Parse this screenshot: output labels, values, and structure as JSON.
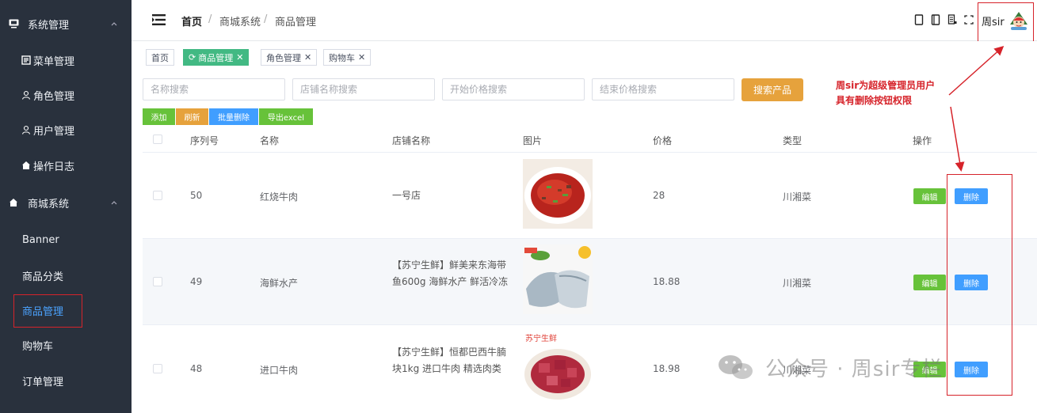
{
  "sidebar": {
    "group1": "系统管理",
    "items1": [
      "菜单管理",
      "角色管理",
      "用户管理",
      "操作日志"
    ],
    "group2": "商城系统",
    "items2": [
      "Banner",
      "商品分类",
      "商品管理",
      "购物车",
      "订单管理"
    ]
  },
  "header": {
    "breadcrumb": [
      "首页",
      "商城系统",
      "商品管理"
    ],
    "username": "周sir"
  },
  "tags": [
    "首页",
    "商品管理",
    "角色管理",
    "购物车"
  ],
  "search": {
    "name_placeholder": "名称搜索",
    "shop_placeholder": "店铺名称搜索",
    "min_price_placeholder": "开始价格搜索",
    "max_price_placeholder": "结束价格搜索",
    "button": "搜索产品"
  },
  "actions": {
    "add": "添加",
    "refresh": "刷新",
    "batch_delete": "批量删除",
    "export": "导出excel"
  },
  "table": {
    "columns": [
      "序列号",
      "名称",
      "店铺名称",
      "图片",
      "价格",
      "类型",
      "操作"
    ],
    "rows": [
      {
        "id": "50",
        "name": "红烧牛肉",
        "shop": "一号店",
        "price": "28",
        "type": "川湘菜"
      },
      {
        "id": "49",
        "name": "海鲜水产",
        "shop": "【苏宁生鲜】鲜美来东海带鱼600g 海鲜水产 鲜活冷冻",
        "price": "18.88",
        "type": "川湘菜"
      },
      {
        "id": "48",
        "name": "进口牛肉",
        "shop": "【苏宁生鲜】恒都巴西牛腩块1kg 进口牛肉 精选肉类",
        "price": "18.98",
        "type": "川湘菜"
      }
    ],
    "edit_label": "编辑",
    "delete_label": "删除",
    "image_badge": "苏宁生鲜"
  },
  "annotation": {
    "line1": "周sir为超级管理员用户",
    "line2": "具有删除按钮权限"
  },
  "watermark": "公众号 · 周sir专栏",
  "colors": {
    "sidebar_bg": "#29313d",
    "active_menu": "#4ba3ff",
    "tag_active": "#42b983",
    "search_btn": "#e6a23c",
    "edit_btn": "#67c23a",
    "delete_btn": "#409eff",
    "annotation": "#d6232a"
  }
}
